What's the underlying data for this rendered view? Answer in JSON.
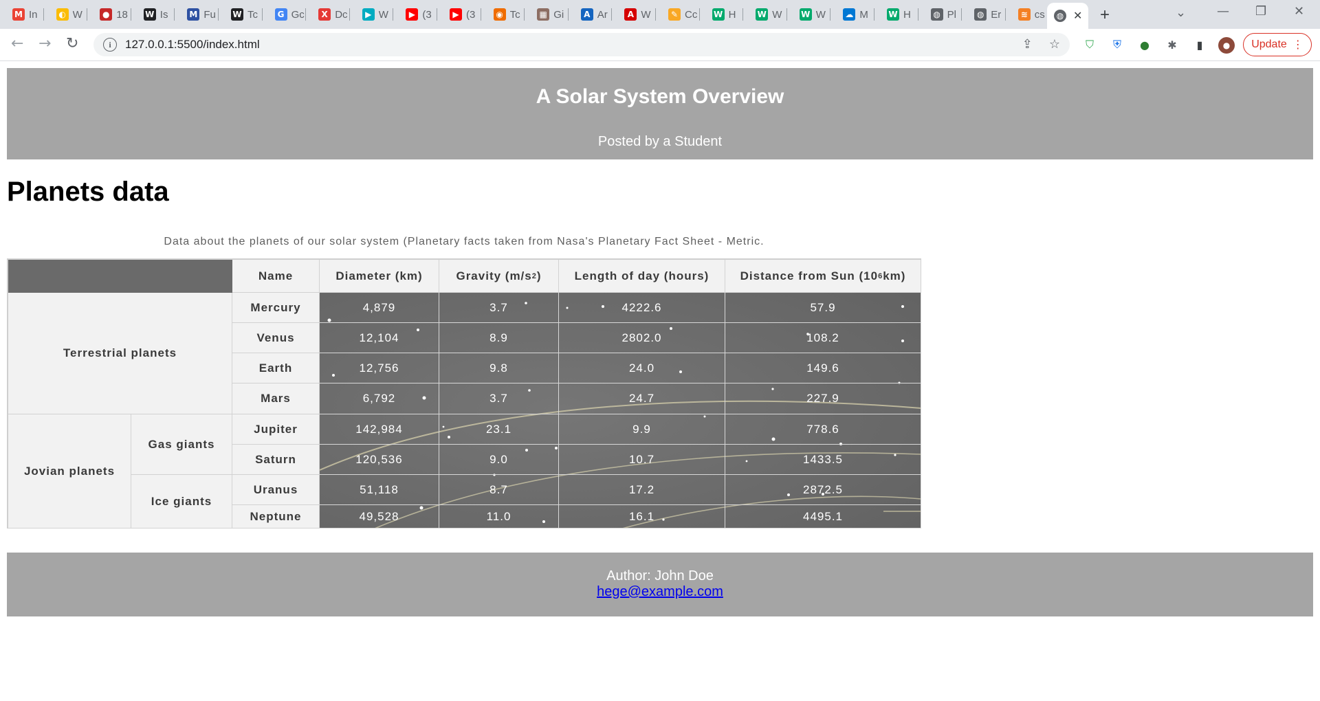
{
  "browser": {
    "tabs": [
      {
        "title": "In",
        "icon": "gmail-icon",
        "color": "#ea4335",
        "glyph": "M"
      },
      {
        "title": "W",
        "icon": "colorful-swirl-icon",
        "color": "#fbbc05",
        "glyph": "◐"
      },
      {
        "title": "18",
        "icon": "red-circle-icon",
        "color": "#c62828",
        "glyph": "●"
      },
      {
        "title": "Is",
        "icon": "wikipedia-icon",
        "color": "#202124",
        "glyph": "W"
      },
      {
        "title": "Fu",
        "icon": "mal-icon",
        "color": "#2e51a2",
        "glyph": "M"
      },
      {
        "title": "Tc",
        "icon": "wikipedia-icon",
        "color": "#202124",
        "glyph": "W"
      },
      {
        "title": "Gc",
        "icon": "google-translate-icon",
        "color": "#4285f4",
        "glyph": "G"
      },
      {
        "title": "Dc",
        "icon": "x-icon",
        "color": "#e53935",
        "glyph": "X"
      },
      {
        "title": "W",
        "icon": "play-circle-icon",
        "color": "#00acc1",
        "glyph": "▶"
      },
      {
        "title": "(3",
        "icon": "youtube-icon",
        "color": "#ff0000",
        "glyph": "▶"
      },
      {
        "title": "(3",
        "icon": "youtube-icon",
        "color": "#ff0000",
        "glyph": "▶"
      },
      {
        "title": "Tc",
        "icon": "shield-orange-icon",
        "color": "#ef6c00",
        "glyph": "◉"
      },
      {
        "title": "Gi",
        "icon": "image-thumb-icon",
        "color": "#8d6e63",
        "glyph": "▦"
      },
      {
        "title": "Ar",
        "icon": "airline-icon",
        "color": "#1565c0",
        "glyph": "A"
      },
      {
        "title": "W",
        "icon": "ak-icon",
        "color": "#d50000",
        "glyph": "A"
      },
      {
        "title": "Cc",
        "icon": "pencil-icon",
        "color": "#f9a825",
        "glyph": "✎"
      },
      {
        "title": "H",
        "icon": "w3schools-icon",
        "color": "#04aa6d",
        "glyph": "W"
      },
      {
        "title": "W",
        "icon": "w3schools-icon",
        "color": "#04aa6d",
        "glyph": "W"
      },
      {
        "title": "W",
        "icon": "w3schools-icon",
        "color": "#04aa6d",
        "glyph": "W"
      },
      {
        "title": "M",
        "icon": "onedrive-icon",
        "color": "#0078d4",
        "glyph": "☁"
      },
      {
        "title": "H",
        "icon": "w3schools-icon",
        "color": "#04aa6d",
        "glyph": "W"
      },
      {
        "title": "Pl",
        "icon": "globe-icon",
        "color": "#5f6368",
        "glyph": "◍"
      },
      {
        "title": "Er",
        "icon": "globe-icon",
        "color": "#5f6368",
        "glyph": "◍"
      },
      {
        "title": "cs",
        "icon": "stackoverflow-icon",
        "color": "#f48024",
        "glyph": "≋"
      }
    ],
    "url": "127.0.0.1:5500/index.html",
    "update_label": "Update"
  },
  "header": {
    "title": "A Solar System Overview",
    "byline": "Posted by a Student"
  },
  "main": {
    "heading": "Planets data",
    "caption": "Data about the planets of our solar system (Planetary facts taken from Nasa's Planetary Fact Sheet - Metric.",
    "columns": {
      "name": "Name",
      "diameter": "Diameter (km)",
      "gravity_pre": "Gravity (m/s",
      "gravity_sup": "2",
      "gravity_post": ")",
      "day": "Length of day (hours)",
      "dist_pre": "Distance from Sun (10",
      "dist_sup": "6",
      "dist_post": "km)"
    },
    "groups": {
      "terrestrial": "Terrestrial planets",
      "jovian": "Jovian planets",
      "gas": "Gas giants",
      "ice": "Ice giants"
    },
    "planets": [
      {
        "name": "Mercury",
        "diameter": "4,879",
        "gravity": "3.7",
        "day": "4222.6",
        "distance": "57.9"
      },
      {
        "name": "Venus",
        "diameter": "12,104",
        "gravity": "8.9",
        "day": "2802.0",
        "distance": "108.2"
      },
      {
        "name": "Earth",
        "diameter": "12,756",
        "gravity": "9.8",
        "day": "24.0",
        "distance": "149.6"
      },
      {
        "name": "Mars",
        "diameter": "6,792",
        "gravity": "3.7",
        "day": "24.7",
        "distance": "227.9"
      },
      {
        "name": "Jupiter",
        "diameter": "142,984",
        "gravity": "23.1",
        "day": "9.9",
        "distance": "778.6"
      },
      {
        "name": "Saturn",
        "diameter": "120,536",
        "gravity": "9.0",
        "day": "10.7",
        "distance": "1433.5"
      },
      {
        "name": "Uranus",
        "diameter": "51,118",
        "gravity": "8.7",
        "day": "17.2",
        "distance": "2872.5"
      },
      {
        "name": "Neptune",
        "diameter": "49,528",
        "gravity": "11.0",
        "day": "16.1",
        "distance": "4495.1"
      }
    ]
  },
  "footer": {
    "author": "Author: John Doe",
    "email": "hege@example.com"
  }
}
